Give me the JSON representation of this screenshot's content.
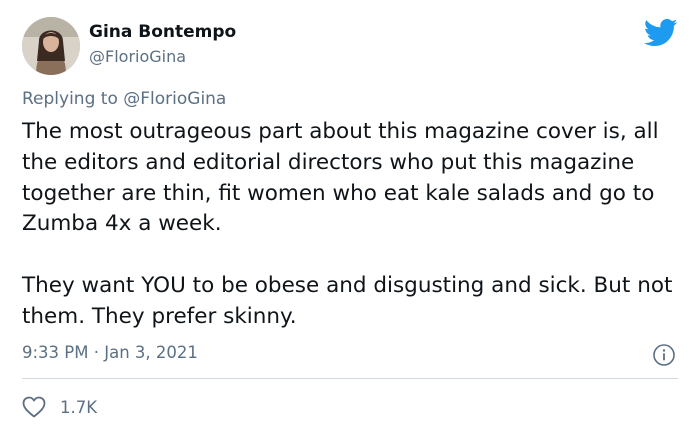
{
  "author": {
    "display_name": "Gina Bontempo",
    "handle": "@FlorioGina",
    "avatar_icon": "profile-photo"
  },
  "platform_icon": "twitter-bird-icon",
  "reply": {
    "prefix": "Replying to",
    "mention": "@FlorioGina"
  },
  "body": {
    "paragraph_1": "The most outrageous part about this magazine cover is, all the editors and editorial directors who put this magazine together are thin, fit women who eat kale salads and go to Zumba 4x a week.",
    "paragraph_2": "They want YOU to be obese and disgusting and sick. But not them. They prefer skinny."
  },
  "meta": {
    "timestamp": "9:33 PM · Jan 3, 2021"
  },
  "actions": {
    "like_count": "1.7K"
  },
  "colors": {
    "text": "#0f1419",
    "secondary": "#5b7083",
    "twitter_blue": "#1d9bf0",
    "divider": "#cfd9de"
  }
}
